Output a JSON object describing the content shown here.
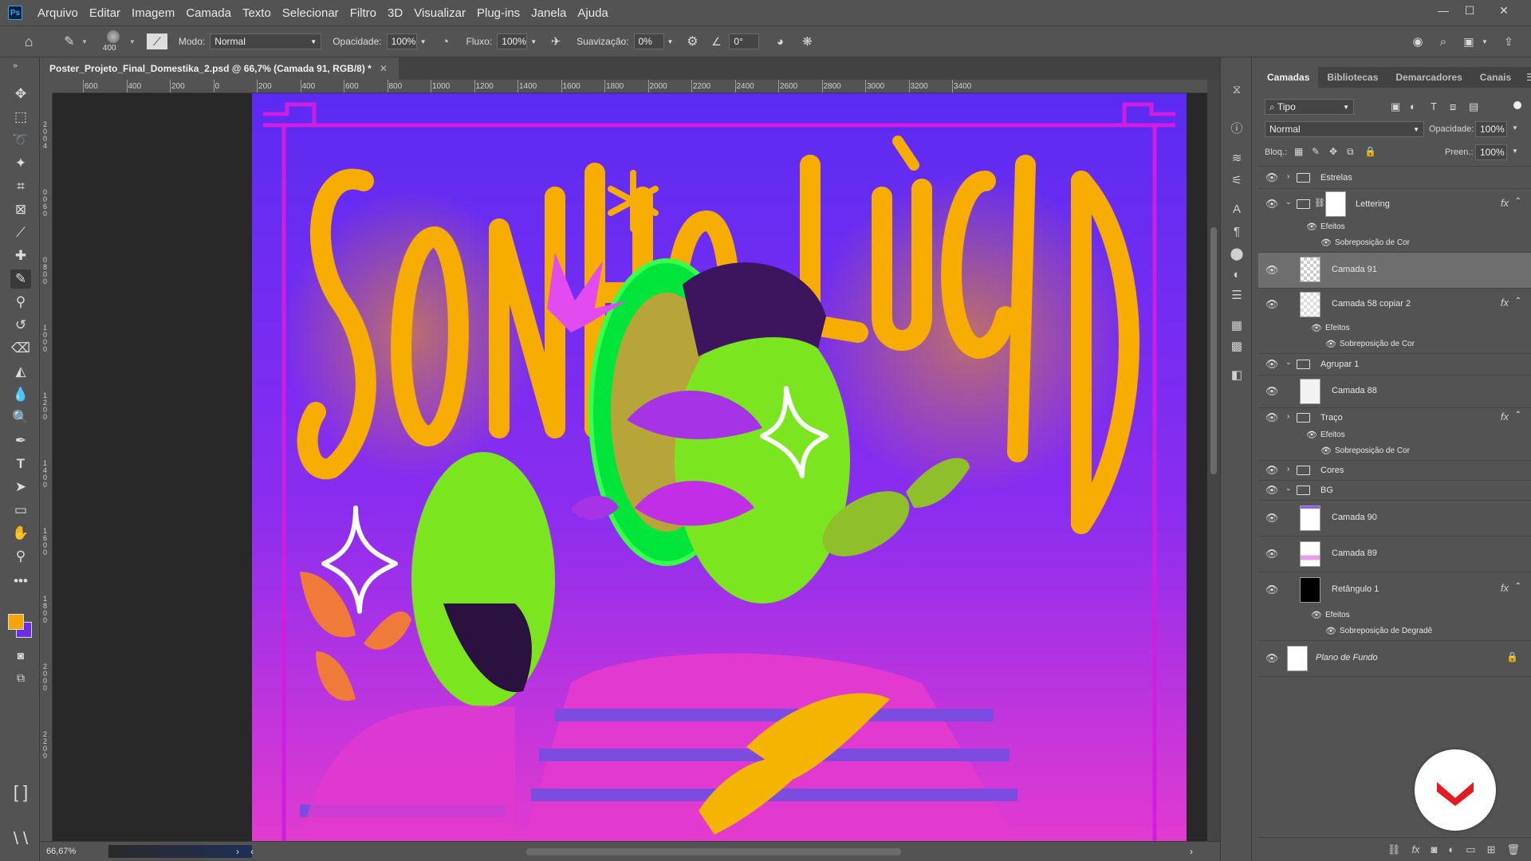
{
  "app": {
    "logo": "Ps"
  },
  "menu": [
    "Arquivo",
    "Editar",
    "Imagem",
    "Camada",
    "Texto",
    "Selecionar",
    "Filtro",
    "3D",
    "Visualizar",
    "Plug-ins",
    "Janela",
    "Ajuda"
  ],
  "options": {
    "brush_size": "400",
    "mode_label": "Modo:",
    "mode_value": "Normal",
    "opacity_label": "Opacidade:",
    "opacity_value": "100%",
    "flow_label": "Fluxo:",
    "flow_value": "100%",
    "smoothing_label": "Suavização:",
    "smoothing_value": "0%",
    "angle_value": "0°"
  },
  "document": {
    "tab_title": "Poster_Projeto_Final_Domestika_2.psd @ 66,7% (Camada 91, RGB/8) *",
    "zoom": "66,67%"
  },
  "ruler_top": [
    "600",
    "400",
    "200",
    "0",
    "200",
    "400",
    "600",
    "800",
    "1000",
    "1200",
    "1400",
    "1600",
    "1800",
    "2000",
    "2200",
    "2400",
    "2600",
    "2800",
    "3000",
    "3200",
    "3400"
  ],
  "ruler_left": [
    "2",
    "0",
    "0",
    "4",
    "0",
    "0",
    "6",
    "0",
    "0",
    "8",
    "0",
    "0",
    "1",
    "0",
    "0",
    "0",
    "1",
    "2",
    "0",
    "0",
    "1",
    "4",
    "0",
    "0",
    "1",
    "6",
    "0",
    "0",
    "1",
    "8",
    "0",
    "0",
    "2",
    "0",
    "0",
    "0",
    "2",
    "2",
    "0",
    "0"
  ],
  "artwork": {
    "title_text": "SONHO*LÚCIDO"
  },
  "panel": {
    "tabs": [
      "Camadas",
      "Bibliotecas",
      "Demarcadores",
      "Canais"
    ],
    "filter_label": "Tipo",
    "blend_mode": "Normal",
    "opacity_label": "Opacidade:",
    "opacity_value": "100%",
    "lock_label": "Bloq.:",
    "fill_label": "Preen.:",
    "fill_value": "100%",
    "layers": [
      {
        "name": "Estrelas"
      },
      {
        "name": "Lettering"
      },
      {
        "name": "Efeitos"
      },
      {
        "name": "Sobreposição de Cor"
      },
      {
        "name": "Camada 91"
      },
      {
        "name": "Camada 58 copiar 2"
      },
      {
        "name": "Efeitos"
      },
      {
        "name": "Sobreposição de Cor"
      },
      {
        "name": "Agrupar 1"
      },
      {
        "name": "Camada 88"
      },
      {
        "name": "Traço"
      },
      {
        "name": "Efeitos"
      },
      {
        "name": "Sobreposição de Cor"
      },
      {
        "name": "Cores"
      },
      {
        "name": "BG"
      },
      {
        "name": "Camada 90"
      },
      {
        "name": "Camada 89"
      },
      {
        "name": "Retângulo 1"
      },
      {
        "name": "Efeitos"
      },
      {
        "name": "Sobreposição de Degradê"
      },
      {
        "name": "Plano de Fundo"
      }
    ],
    "fx_label": "fx"
  },
  "colors": {
    "foreground": "#f5a400",
    "background": "#6a2ee8",
    "accent": "#e81d28"
  }
}
